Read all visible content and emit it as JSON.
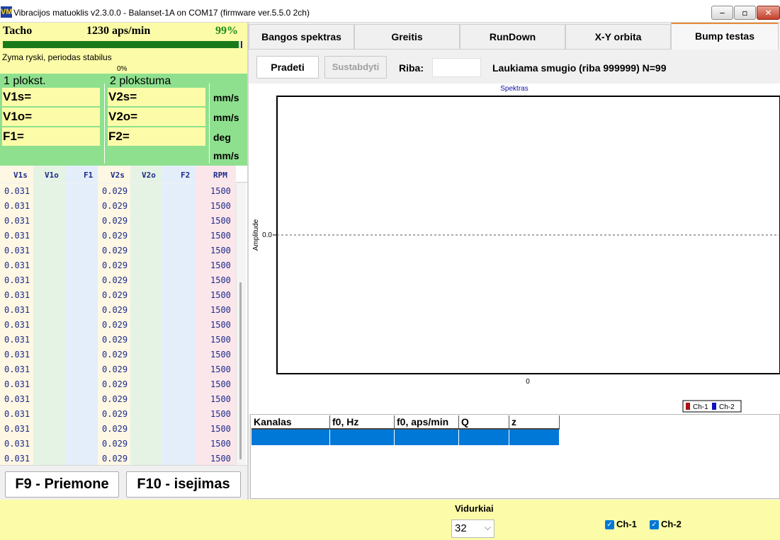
{
  "window": {
    "title": "Vibracijos matuoklis v2.3.0.0 - Balanset-1A on COM17 (firmware ver.5.5.0 2ch)",
    "icon": "app-logo-icon",
    "min": "‒",
    "max": "▫",
    "close": "✕"
  },
  "tacho": {
    "label": "Tacho",
    "value": "1230 aps/min",
    "percent": "99%",
    "progress": 0.99,
    "status": "Zyma ryski, periodas stabilus",
    "small_percent": "0%"
  },
  "planes": {
    "plane1": "1 plokst.",
    "plane2": "2 plokstuma",
    "v1s": "V1s=",
    "v1o": "V1o=",
    "f1": "F1=",
    "v2s": "V2s=",
    "v2o": "V2o=",
    "f2": "F2=",
    "units": [
      "mm/s",
      "mm/s",
      "deg",
      "mm/s"
    ]
  },
  "table": {
    "headers": [
      "V1s",
      "V1o",
      "F1",
      "V2s",
      "V2o",
      "F2",
      "RPM"
    ],
    "rows": [
      [
        "0.031",
        "",
        "",
        "0.029",
        "",
        "",
        "1500"
      ],
      [
        "0.031",
        "",
        "",
        "0.029",
        "",
        "",
        "1500"
      ],
      [
        "0.031",
        "",
        "",
        "0.029",
        "",
        "",
        "1500"
      ],
      [
        "0.031",
        "",
        "",
        "0.029",
        "",
        "",
        "1500"
      ],
      [
        "0.031",
        "",
        "",
        "0.029",
        "",
        "",
        "1500"
      ],
      [
        "0.031",
        "",
        "",
        "0.029",
        "",
        "",
        "1500"
      ],
      [
        "0.031",
        "",
        "",
        "0.029",
        "",
        "",
        "1500"
      ],
      [
        "0.031",
        "",
        "",
        "0.029",
        "",
        "",
        "1500"
      ],
      [
        "0.031",
        "",
        "",
        "0.029",
        "",
        "",
        "1500"
      ],
      [
        "0.031",
        "",
        "",
        "0.029",
        "",
        "",
        "1500"
      ],
      [
        "0.031",
        "",
        "",
        "0.029",
        "",
        "",
        "1500"
      ],
      [
        "0.031",
        "",
        "",
        "0.029",
        "",
        "",
        "1500"
      ],
      [
        "0.031",
        "",
        "",
        "0.029",
        "",
        "",
        "1500"
      ],
      [
        "0.031",
        "",
        "",
        "0.029",
        "",
        "",
        "1500"
      ],
      [
        "0.031",
        "",
        "",
        "0.029",
        "",
        "",
        "1500"
      ],
      [
        "0.031",
        "",
        "",
        "0.029",
        "",
        "",
        "1500"
      ],
      [
        "0.031",
        "",
        "",
        "0.029",
        "",
        "",
        "1500"
      ],
      [
        "0.031",
        "",
        "",
        "0.029",
        "",
        "",
        "1500"
      ],
      [
        "0.031",
        "",
        "",
        "0.029",
        "",
        "",
        "1500"
      ]
    ]
  },
  "footer_buttons": {
    "f9": "F9 - Priemone",
    "f10": "F10 - isejimas"
  },
  "tabs": [
    "Bangos spektras",
    "Greitis",
    "RunDown",
    "X-Y orbita",
    "Bump testas"
  ],
  "active_tab": 4,
  "toolbar": {
    "start": "Pradeti",
    "stop": "Sustabdyti",
    "riba_label": "Riba:",
    "riba_value": "",
    "status": "Laukiama smugio (riba 999999)  N=99"
  },
  "chart_data": {
    "type": "line",
    "title": "Spektras",
    "ylabel": "Amplitude",
    "xlabel": "",
    "x_ticks": [
      "0"
    ],
    "y_ticks": [
      "0.0"
    ],
    "series": [
      {
        "name": "Ch-1",
        "color": "#b01010",
        "values": []
      },
      {
        "name": "Ch-2",
        "color": "#1010c0",
        "values": []
      }
    ],
    "zero_line": "dashed"
  },
  "results_table": {
    "headers": [
      "Kanalas",
      "f0, Hz",
      "f0, aps/min",
      "Q",
      "z"
    ],
    "rows": [
      [
        "",
        "",
        "",
        "",
        ""
      ]
    ]
  },
  "bottom": {
    "averaging_label": "Vidurkiai",
    "averaging_value": "32",
    "ch1_label": "Ch-1",
    "ch2_label": "Ch-2",
    "ch1_checked": true,
    "ch2_checked": true
  }
}
